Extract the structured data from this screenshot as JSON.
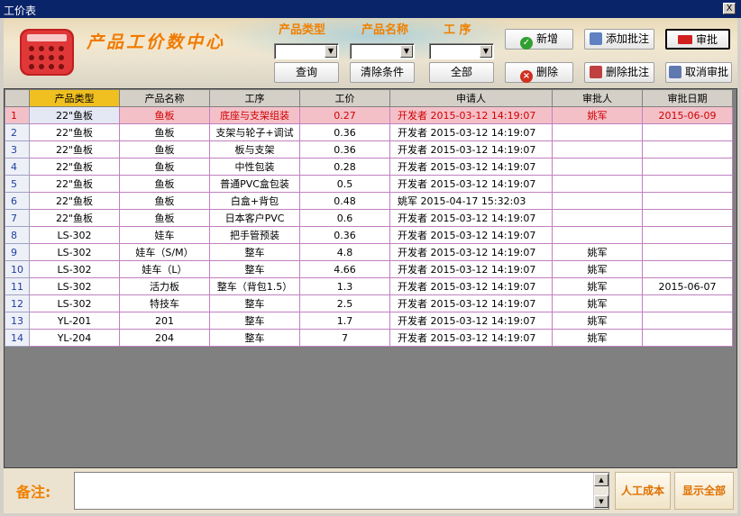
{
  "window": {
    "title": "工价表",
    "close_glyph": "X"
  },
  "header": {
    "app_title": "产品工价数中心",
    "filter_labels": [
      "产品类型",
      "产品名称",
      "工  序"
    ],
    "combos": [
      {
        "value": "",
        "arrow": "▼"
      },
      {
        "value": "",
        "arrow": "▼"
      },
      {
        "value": "",
        "arrow": "▼"
      }
    ]
  },
  "toolbar": {
    "query": "查询",
    "clear": "清除条件",
    "all": "全部",
    "add": "新增",
    "delete": "删除",
    "add_batch": "添加批注",
    "delete_batch": "删除批注",
    "approve": "审批",
    "cancel_approve": "取消审批"
  },
  "icons": {
    "add": "check-circle-icon",
    "delete": "x-circle-icon",
    "add_batch": "note-add-icon",
    "delete_batch": "note-delete-icon",
    "approve": "approve-flag-icon",
    "cancel_approve": "cancel-approve-icon"
  },
  "table": {
    "columns": [
      "产品类型",
      "产品名称",
      "工序",
      "工价",
      "申请人",
      "审批人",
      "审批日期"
    ],
    "rows": [
      {
        "n": "1",
        "c": [
          "22\"鱼板",
          "鱼板",
          "底座与支架组装",
          "0.27",
          "开发者 2015-03-12 14:19:07",
          "姚军",
          "2015-06-09"
        ]
      },
      {
        "n": "2",
        "c": [
          "22\"鱼板",
          "鱼板",
          "支架与轮子+调试",
          "0.36",
          "开发者 2015-03-12 14:19:07",
          "",
          ""
        ]
      },
      {
        "n": "3",
        "c": [
          "22\"鱼板",
          "鱼板",
          "板与支架",
          "0.36",
          "开发者 2015-03-12 14:19:07",
          "",
          ""
        ]
      },
      {
        "n": "4",
        "c": [
          "22\"鱼板",
          "鱼板",
          "中性包装",
          "0.28",
          "开发者 2015-03-12 14:19:07",
          "",
          ""
        ]
      },
      {
        "n": "5",
        "c": [
          "22\"鱼板",
          "鱼板",
          "普通PVC盒包装",
          "0.5",
          "开发者 2015-03-12 14:19:07",
          "",
          ""
        ]
      },
      {
        "n": "6",
        "c": [
          "22\"鱼板",
          "鱼板",
          "白盒+背包",
          "0.48",
          "姚军 2015-04-17 15:32:03",
          "",
          ""
        ]
      },
      {
        "n": "7",
        "c": [
          "22\"鱼板",
          "鱼板",
          "日本客户PVC",
          "0.6",
          "开发者 2015-03-12 14:19:07",
          "",
          ""
        ]
      },
      {
        "n": "8",
        "c": [
          "LS-302",
          "娃车",
          "把手管预装",
          "0.36",
          "开发者 2015-03-12 14:19:07",
          "",
          ""
        ]
      },
      {
        "n": "9",
        "c": [
          "LS-302",
          "娃车（S/M）",
          "整车",
          "4.8",
          "开发者 2015-03-12 14:19:07",
          "姚军",
          ""
        ]
      },
      {
        "n": "10",
        "c": [
          "LS-302",
          "娃车（L）",
          "整车",
          "4.66",
          "开发者 2015-03-12 14:19:07",
          "姚军",
          ""
        ]
      },
      {
        "n": "11",
        "c": [
          "LS-302",
          "活力板",
          "整车（背包1.5）",
          "1.3",
          "开发者 2015-03-12 14:19:07",
          "姚军",
          "2015-06-07"
        ]
      },
      {
        "n": "12",
        "c": [
          "LS-302",
          "特技车",
          "整车",
          "2.5",
          "开发者 2015-03-12 14:19:07",
          "姚军",
          ""
        ]
      },
      {
        "n": "13",
        "c": [
          "YL-201",
          "201",
          "整车",
          "1.7",
          "开发者 2015-03-12 14:19:07",
          "姚军",
          ""
        ]
      },
      {
        "n": "14",
        "c": [
          "YL-204",
          "204",
          "整车",
          "7",
          "开发者 2015-03-12 14:19:07",
          "姚军",
          ""
        ]
      }
    ]
  },
  "footer": {
    "remark_label": "备注:",
    "remark_value": "",
    "labor_cost": "人工成本",
    "show_all": "显示全部",
    "scroll_up": "▲",
    "scroll_down": "▼"
  },
  "colors": {
    "title_orange": "#f07a00",
    "selected_row": "#f4c0c8",
    "selected_text": "#d00000",
    "header_selected": "#f0c020",
    "grid_line": "#c080c0",
    "titlebar": "#0a246a"
  }
}
